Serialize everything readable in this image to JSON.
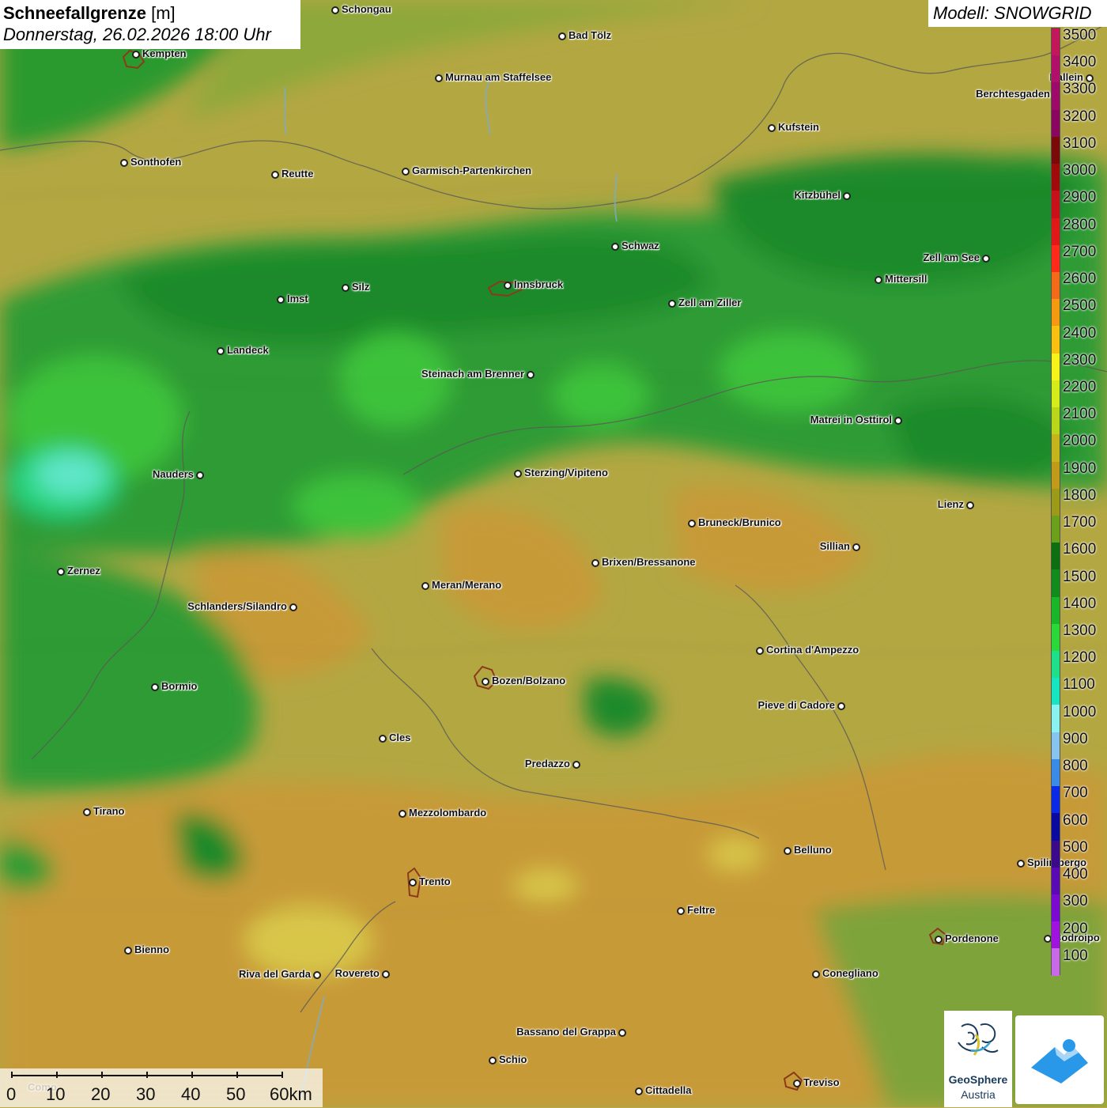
{
  "header": {
    "title_bold": "Schneefallgrenze",
    "title_unit": "[m]",
    "datetime": "Donnerstag, 26.02.2026 18:00 Uhr",
    "model": "Modell: SNOWGRID"
  },
  "legend": {
    "unit": "m",
    "levels": [
      {
        "label": "3500",
        "color": "#c2185b"
      },
      {
        "label": "3400",
        "color": "#b0106a"
      },
      {
        "label": "3300",
        "color": "#9c0a6a"
      },
      {
        "label": "3200",
        "color": "#8a0660"
      },
      {
        "label": "3100",
        "color": "#7a0a0a"
      },
      {
        "label": "3000",
        "color": "#a00a0a"
      },
      {
        "label": "2900",
        "color": "#c8101a"
      },
      {
        "label": "2800",
        "color": "#e01818"
      },
      {
        "label": "2700",
        "color": "#ff2a1a"
      },
      {
        "label": "2600",
        "color": "#f26a1a"
      },
      {
        "label": "2500",
        "color": "#f59a10"
      },
      {
        "label": "2400",
        "color": "#f8c010"
      },
      {
        "label": "2300",
        "color": "#f6f21a"
      },
      {
        "label": "2200",
        "color": "#d4ec1a"
      },
      {
        "label": "2100",
        "color": "#b9d61a"
      },
      {
        "label": "2000",
        "color": "#c6b41c"
      },
      {
        "label": "1900",
        "color": "#c09a18"
      },
      {
        "label": "1800",
        "color": "#9c9a18"
      },
      {
        "label": "1700",
        "color": "#6aa01c"
      },
      {
        "label": "1600",
        "color": "#0e6e12"
      },
      {
        "label": "1500",
        "color": "#118a1e"
      },
      {
        "label": "1400",
        "color": "#1ab62a"
      },
      {
        "label": "1300",
        "color": "#2ad83a"
      },
      {
        "label": "1200",
        "color": "#1ee08a"
      },
      {
        "label": "1100",
        "color": "#16e4c2"
      },
      {
        "label": "1000",
        "color": "#8af2f0"
      },
      {
        "label": "900",
        "color": "#88c4f0"
      },
      {
        "label": "800",
        "color": "#3a8ae8"
      },
      {
        "label": "700",
        "color": "#0a2ae8"
      },
      {
        "label": "600",
        "color": "#0a0aa0"
      },
      {
        "label": "500",
        "color": "#3a0a8a"
      },
      {
        "label": "400",
        "color": "#5a0ab4"
      },
      {
        "label": "300",
        "color": "#7a0ad2"
      },
      {
        "label": "200",
        "color": "#a012e0"
      },
      {
        "label": "100",
        "color": "#c86ae8"
      }
    ]
  },
  "places": [
    {
      "name": "Schongau"
    },
    {
      "name": "Bad Tölz"
    },
    {
      "name": "Kempten"
    },
    {
      "name": "Murnau am Staffelsee"
    },
    {
      "name": "Hallein"
    },
    {
      "name": "Berchtesgaden"
    },
    {
      "name": "Kufstein"
    },
    {
      "name": "Sonthofen"
    },
    {
      "name": "Reutte"
    },
    {
      "name": "Garmisch-Partenkirchen"
    },
    {
      "name": "Kitzbühel"
    },
    {
      "name": "Schwaz"
    },
    {
      "name": "Zell am See"
    },
    {
      "name": "Innsbruck"
    },
    {
      "name": "Mittersill"
    },
    {
      "name": "Imst"
    },
    {
      "name": "Silz"
    },
    {
      "name": "Zell am Ziller"
    },
    {
      "name": "Landeck"
    },
    {
      "name": "Steinach am Brenner"
    },
    {
      "name": "Matrei in Osttirol"
    },
    {
      "name": "Nauders"
    },
    {
      "name": "Sterzing/Vipiteno"
    },
    {
      "name": "Lienz"
    },
    {
      "name": "Bruneck/Brunico"
    },
    {
      "name": "Sillian"
    },
    {
      "name": "Brixen/Bressanone"
    },
    {
      "name": "Zernez"
    },
    {
      "name": "Meran/Merano"
    },
    {
      "name": "Schlanders/Silandro"
    },
    {
      "name": "Cortina d'Ampezzo"
    },
    {
      "name": "Bozen/Bolzano"
    },
    {
      "name": "Bormio"
    },
    {
      "name": "Pieve di Cadore"
    },
    {
      "name": "Cles"
    },
    {
      "name": "Predazzo"
    },
    {
      "name": "Tirano"
    },
    {
      "name": "Mezzolombardo"
    },
    {
      "name": "Belluno"
    },
    {
      "name": "Spilimbergo"
    },
    {
      "name": "Trento"
    },
    {
      "name": "Feltre"
    },
    {
      "name": "Pordenone"
    },
    {
      "name": "Codroipo"
    },
    {
      "name": "Bienno"
    },
    {
      "name": "Riva del Garda"
    },
    {
      "name": "Rovereto"
    },
    {
      "name": "Conegliano"
    },
    {
      "name": "Bassano del Grappa"
    },
    {
      "name": "Schio"
    },
    {
      "name": "Treviso"
    },
    {
      "name": "Cittadella"
    },
    {
      "name": "Como"
    }
  ],
  "scalebar": {
    "labels": [
      "0",
      "10",
      "20",
      "30",
      "40",
      "50",
      "60km"
    ]
  },
  "logos": {
    "geosphere_line1": "GeoSphere",
    "geosphere_line2": "Austria"
  }
}
